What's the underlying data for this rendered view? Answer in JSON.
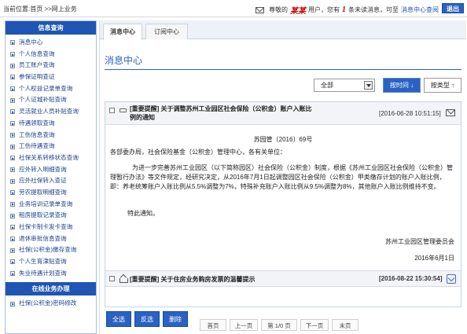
{
  "header": {
    "breadcrumb": "当前位置:首页 >>网上业务",
    "greeting_prefix": "尊敬的",
    "user_name": "某某",
    "greeting_mid": "用户，您有",
    "unread_count": "1",
    "greeting_suffix": "条未读消息，可至",
    "message_center_link": "消息中心查阅",
    "logout_label": "退出"
  },
  "sidebar": {
    "section1_title": "信息查询",
    "items": [
      "消息中心",
      "个人信息查询",
      "员工账户查询",
      "参保证明查证",
      "个人权益记录单查询",
      "个人证城补贴查询",
      "灵活就业人员补贴查询",
      "待遇领取查询",
      "工伤信息查询",
      "工伤待遇查询",
      "社保关系转移状态查询",
      "应外转入明细查询",
      "应外社保转入查证",
      "劳农提取明细查询",
      "业务培训记录单查询",
      "租房提取记录查询",
      "社保卡制卡发卡查询",
      "退休审批信息查询",
      "社保(公积金)缴存查询",
      "个人生育津贴查询",
      "失业待遇计划查询"
    ],
    "section2_title": "在线业务办理",
    "items2": [
      "社保(公积金)密码修改"
    ]
  },
  "tabs": [
    {
      "label": "消息中心",
      "active": true
    },
    {
      "label": "订阅中心",
      "active": false
    }
  ],
  "main": {
    "title": "消息中心",
    "filter_value": "全部",
    "sort_time_label": "按时间 ↓",
    "sort_type_label": "按类型 ↑"
  },
  "messages": [
    {
      "title": "[重要提醒] 关于调整苏州工业园区社会保险（公积金）账户入账比例的通知",
      "date": "[2016-06-28 10:51:15]",
      "read": true,
      "doc_no": "苏园管〔2016〕69号",
      "salutation": "各部委办局，社会保险基金（公积金）管理中心，各有关单位：",
      "paragraph": "为进一步完善苏州工业园区（以下简称园区）社会保险（公积金）制度，根据《苏州工业园区社会保险（公积金）管理暂行办法》等文件规定，经研究决定，从2016年7月1日起调整园区社会保险（公积金）甲类缴存计划的账户入账比例，即：养老统筹账户入账比例从5.5%调整为7%，特殊补充账户入账比例从9.5%调整为8%，其他账户入账比例维持不变。",
      "notice": "特此通知。",
      "signature": "苏州工业园区管理委员会",
      "sign_date": "2016年6月1日"
    },
    {
      "title": "[重要提醒] 关于住房业务购房发票的温馨提示",
      "date": "[2016-08-22 15:30:54]",
      "read": false
    }
  ],
  "actions": {
    "select_all": "全选",
    "invert": "反选",
    "delete": "删除"
  },
  "pager": {
    "first": "首页",
    "prev": "上一页",
    "info": "第 1/0 页",
    "next": "下一页",
    "last": "末页"
  },
  "colors": {
    "accent": "#2a62c4",
    "sidebar_header": "#1f55b3",
    "highlight_red": "#cc0000"
  }
}
